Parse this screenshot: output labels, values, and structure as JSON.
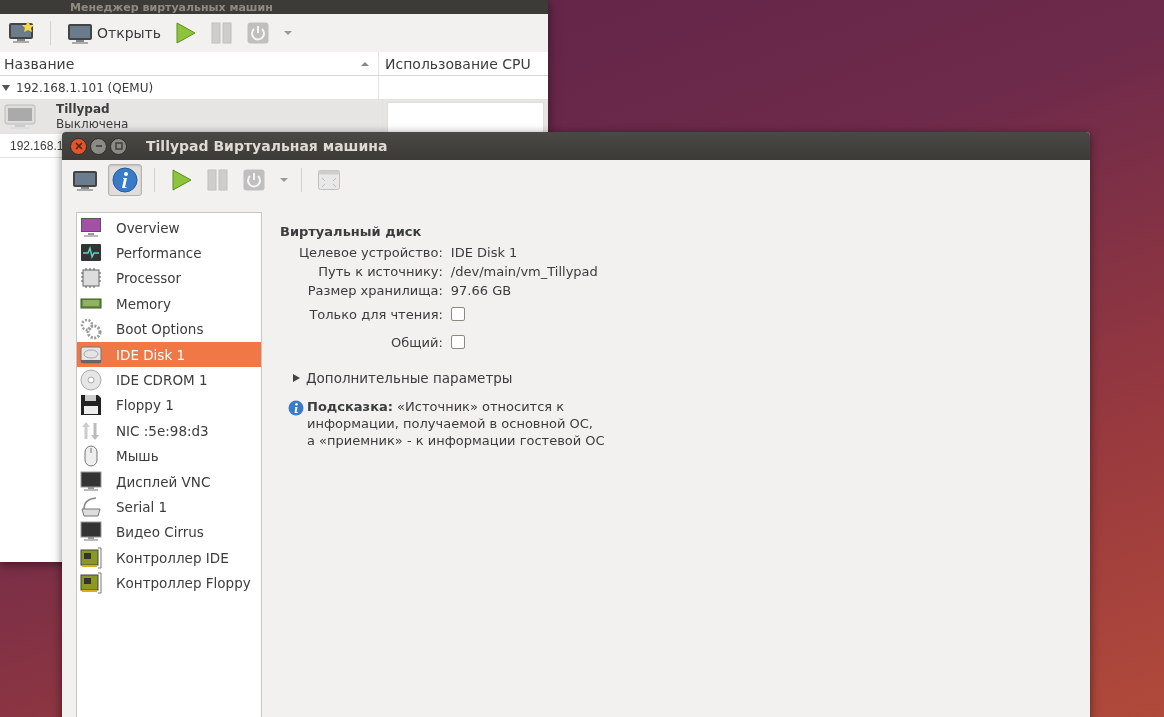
{
  "manager_window": {
    "title": "Менеджер виртуальных машин",
    "toolbar": {
      "open_label": "Открыть",
      "actions": [
        {
          "kind": "run",
          "disabled": false
        },
        {
          "kind": "pause",
          "disabled": true
        },
        {
          "kind": "shutdown",
          "disabled": true
        }
      ]
    },
    "columns": [
      {
        "label": "Название",
        "sorted": true
      },
      {
        "label": "Использование CPU",
        "sorted": false
      }
    ],
    "groups": [
      {
        "label": "192.168.1.101 (QEMU)",
        "expanded": true,
        "vms": [
          {
            "name": "Tillypad",
            "status": "Выключена",
            "selected": true
          }
        ]
      },
      {
        "label": "192.168.1"
      }
    ]
  },
  "vm_window": {
    "title": "Tillypad Виртуальная машина",
    "toolbar": {
      "views": [
        {
          "kind": "console",
          "selected": false
        },
        {
          "kind": "details",
          "selected": true
        }
      ],
      "actions": [
        {
          "kind": "run",
          "disabled": false
        },
        {
          "kind": "pause",
          "disabled": true
        },
        {
          "kind": "shutdown",
          "disabled": true
        },
        {
          "kind": "fullscreen",
          "disabled": true
        }
      ]
    },
    "hardware": [
      {
        "label": "Overview",
        "kind": "overview",
        "selected": false
      },
      {
        "label": "Performance",
        "kind": "performance",
        "selected": false
      },
      {
        "label": "Processor",
        "kind": "cpu",
        "selected": false
      },
      {
        "label": "Memory",
        "kind": "memory",
        "selected": false
      },
      {
        "label": "Boot Options",
        "kind": "boot",
        "selected": false
      },
      {
        "label": "IDE Disk 1",
        "kind": "disk",
        "selected": true
      },
      {
        "label": "IDE CDROM 1",
        "kind": "cdrom",
        "selected": false
      },
      {
        "label": "Floppy 1",
        "kind": "floppy",
        "selected": false
      },
      {
        "label": "NIC :5e:98:d3",
        "kind": "nic",
        "selected": false
      },
      {
        "label": "Мышь",
        "kind": "mouse",
        "selected": false
      },
      {
        "label": "Дисплей VNC",
        "kind": "display",
        "selected": false
      },
      {
        "label": "Serial 1",
        "kind": "serial",
        "selected": false
      },
      {
        "label": "Видео Cirrus",
        "kind": "display",
        "selected": false
      },
      {
        "label": "Контроллер IDE",
        "kind": "controller",
        "selected": false
      },
      {
        "label": "Контроллер Floppy",
        "kind": "controller",
        "selected": false
      }
    ],
    "details": {
      "heading": "Виртуальный диск",
      "fields": [
        {
          "label": "Целевое устройство:",
          "kind": "text",
          "value": "IDE Disk 1"
        },
        {
          "label": "Путь к источнику:",
          "kind": "text",
          "value": "/dev/main/vm_Tillypad"
        },
        {
          "label": "Размер хранилища:",
          "kind": "text",
          "value": "97.66 GB"
        },
        {
          "label": "Только для чтения:",
          "kind": "checkbox",
          "checked": false
        },
        {
          "label": "Общий:",
          "kind": "checkbox",
          "checked": false
        }
      ],
      "expander": {
        "label": "Дополнительные параметры",
        "expanded": false
      },
      "hint_lines": [
        "**Подсказка:** «Источник» относится к",
        "информации, получаемой в основной ОС,",
        "а «приемник» - к информации гостевой ОС"
      ]
    }
  }
}
